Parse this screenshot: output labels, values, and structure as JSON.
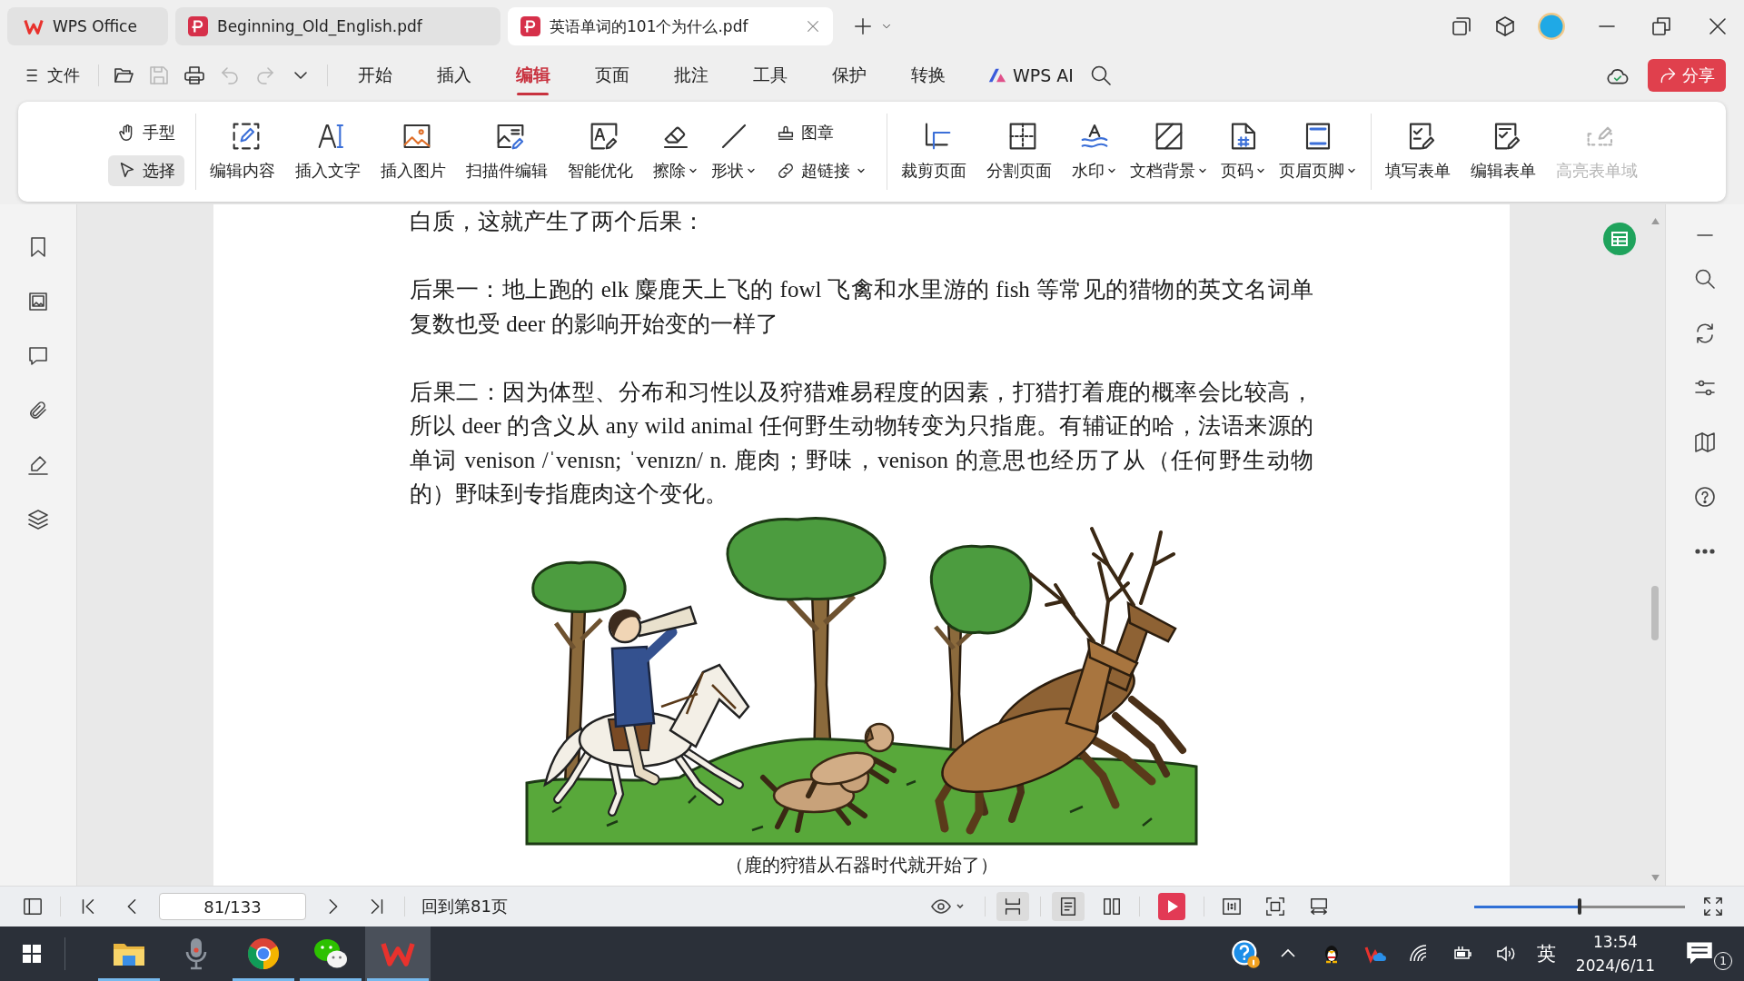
{
  "tabs": [
    {
      "label": "WPS Office",
      "kind": "home",
      "selected": false
    },
    {
      "label": "Beginning_Old_English.pdf",
      "kind": "pdf",
      "selected": false
    },
    {
      "label": "英语单词的101个为什么.pdf",
      "kind": "pdf",
      "selected": true
    }
  ],
  "menu": {
    "file_label": "文件",
    "quick_access": [
      {
        "disabled": false
      },
      {
        "disabled": true
      },
      {
        "disabled": false
      },
      {
        "disabled": true
      },
      {
        "disabled": true
      }
    ],
    "tabs": [
      {
        "label": "开始",
        "kind": "text",
        "selected": false
      },
      {
        "label": "插入",
        "kind": "text",
        "selected": false
      },
      {
        "label": "编辑",
        "kind": "text",
        "selected": true
      },
      {
        "label": "页面",
        "kind": "text",
        "selected": false
      },
      {
        "label": "批注",
        "kind": "text",
        "selected": false
      },
      {
        "label": "工具",
        "kind": "text",
        "selected": false
      },
      {
        "label": "保护",
        "kind": "text",
        "selected": false
      },
      {
        "label": "转换",
        "kind": "text",
        "selected": false
      },
      {
        "label": "WPS AI",
        "kind": "ai",
        "selected": false
      }
    ],
    "share_label": "分享"
  },
  "ribbon": {
    "groups": [
      {
        "items": [
          {
            "kind": "stack",
            "items": [
              {
                "label": "手型",
                "selected": false,
                "dropdown": false,
                "disabled": false
              },
              {
                "label": "选择",
                "selected": true,
                "dropdown": false,
                "disabled": false
              }
            ]
          }
        ]
      },
      {
        "items": [
          {
            "kind": "big",
            "label": "编辑内容",
            "dropdown": false,
            "disabled": false
          },
          {
            "kind": "big",
            "label": "插入文字",
            "dropdown": false,
            "disabled": false
          },
          {
            "kind": "big",
            "label": "插入图片",
            "dropdown": false,
            "disabled": false
          },
          {
            "kind": "big",
            "label": "扫描件编辑",
            "dropdown": false,
            "disabled": false
          },
          {
            "kind": "big",
            "label": "智能优化",
            "dropdown": false,
            "disabled": false
          },
          {
            "kind": "big",
            "label": "擦除",
            "dropdown": true,
            "disabled": false
          },
          {
            "kind": "big",
            "label": "形状",
            "dropdown": true,
            "disabled": false
          },
          {
            "kind": "stack",
            "items": [
              {
                "label": "图章",
                "dropdown": false,
                "disabled": false
              },
              {
                "label": "超链接",
                "dropdown": true,
                "disabled": false
              }
            ]
          }
        ]
      },
      {
        "items": [
          {
            "kind": "big",
            "label": "裁剪页面",
            "dropdown": false,
            "disabled": false
          },
          {
            "kind": "big",
            "label": "分割页面",
            "dropdown": false,
            "disabled": false
          },
          {
            "kind": "big",
            "label": "水印",
            "dropdown": true,
            "disabled": false
          },
          {
            "kind": "big",
            "label": "文档背景",
            "dropdown": true,
            "disabled": false
          },
          {
            "kind": "big",
            "label": "页码",
            "dropdown": true,
            "disabled": false
          },
          {
            "kind": "big",
            "label": "页眉页脚",
            "dropdown": true,
            "disabled": false
          }
        ]
      },
      {
        "items": [
          {
            "kind": "big",
            "label": "填写表单",
            "dropdown": false,
            "disabled": false
          },
          {
            "kind": "big",
            "label": "编辑表单",
            "dropdown": false,
            "disabled": false
          },
          {
            "kind": "big",
            "label": "高亮表单域",
            "dropdown": false,
            "disabled": true
          }
        ]
      }
    ]
  },
  "document": {
    "paragraphs": [
      "白质，这就产生了两个后果：",
      "后果一：地上跑的 elk 麋鹿天上飞的 fowl 飞禽和水里游的 fish 等常见的猎物的英文名词单复数也受 deer 的影响开始变的一样了",
      "后果二：因为体型、分布和习性以及狩猎难易程度的因素，打猎打着鹿的概率会比较高，所以 deer 的含义从 any wild animal 任何野生动物转变为只指鹿。有辅证的哈，法语来源的单词 venison /ˈvenɪsn; ˈvenɪzn/ n. 鹿肉；野味，venison 的意思也经历了从（任何野生动物的）野味到专指鹿肉这个变化。"
    ],
    "figure_caption": "（鹿的狩猎从石器时代就开始了）"
  },
  "status_bar": {
    "page_field": "81/133",
    "back_link": "回到第81页",
    "view_modes": [
      {
        "selected": true
      },
      {
        "selected": true
      },
      {
        "selected": false
      }
    ],
    "zoom_slider": {
      "level": 0.5
    }
  },
  "taskbar": {
    "apps": [
      {
        "running": true,
        "selected": false
      },
      {
        "running": false,
        "selected": false
      },
      {
        "running": true,
        "selected": false
      },
      {
        "running": true,
        "selected": false
      },
      {
        "running": true,
        "selected": true
      }
    ],
    "input_method": "英",
    "time": "13:54",
    "date": "2024/6/11",
    "notification_count": "1"
  }
}
